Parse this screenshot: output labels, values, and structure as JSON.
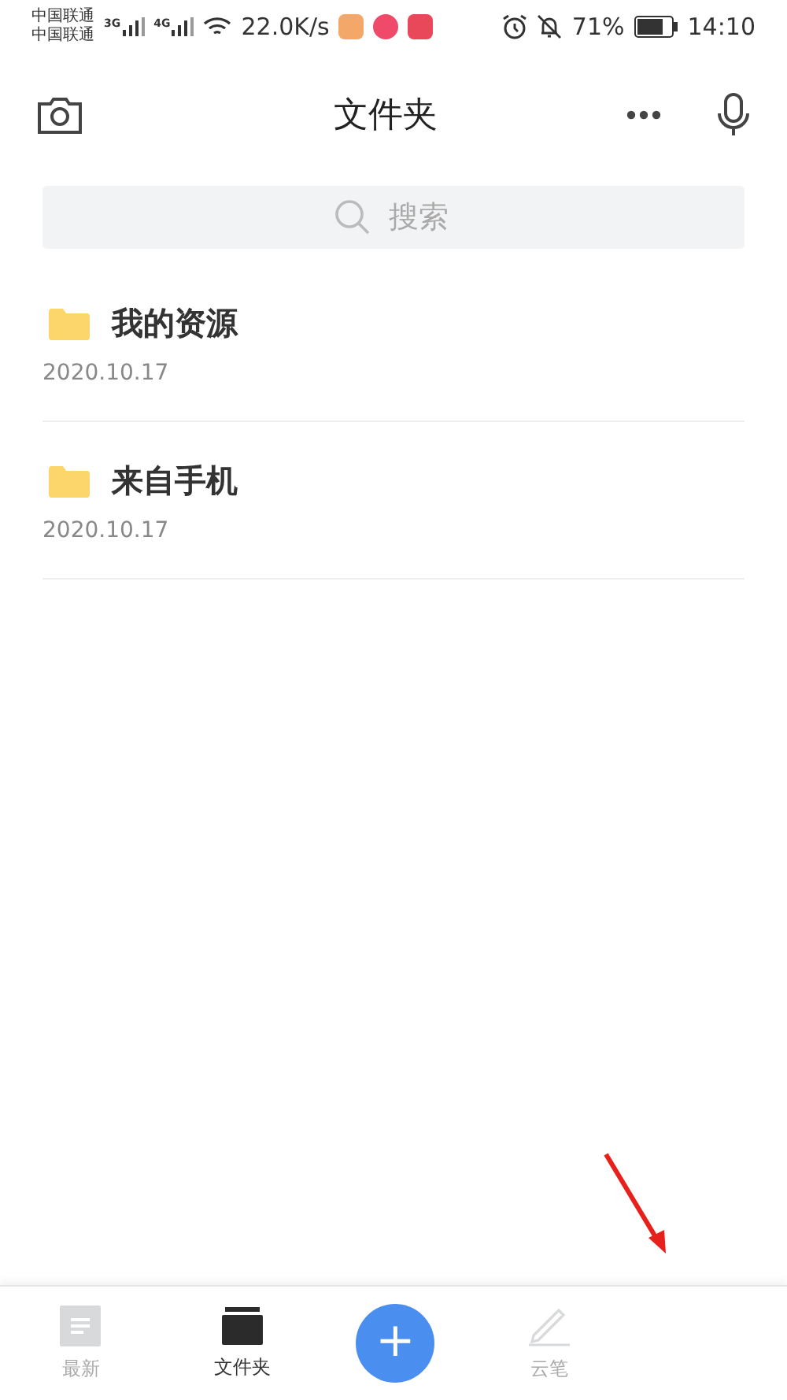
{
  "status_bar": {
    "carriers": [
      "中国联通",
      "中国联通"
    ],
    "networks": [
      "3G",
      "4G"
    ],
    "speed": "22.0K/s",
    "battery": "71%",
    "time": "14:10"
  },
  "header": {
    "title": "文件夹"
  },
  "search": {
    "placeholder": "搜索"
  },
  "folders": [
    {
      "name": "我的资源",
      "date": "2020.10.17"
    },
    {
      "name": "来自手机",
      "date": "2020.10.17"
    }
  ],
  "nav": [
    {
      "kind": "tab",
      "label": "最新",
      "selected": false
    },
    {
      "kind": "tab",
      "label": "文件夹",
      "selected": true
    },
    {
      "kind": "add",
      "label": "+"
    },
    {
      "kind": "tab",
      "label": "云笔",
      "selected": false
    }
  ]
}
